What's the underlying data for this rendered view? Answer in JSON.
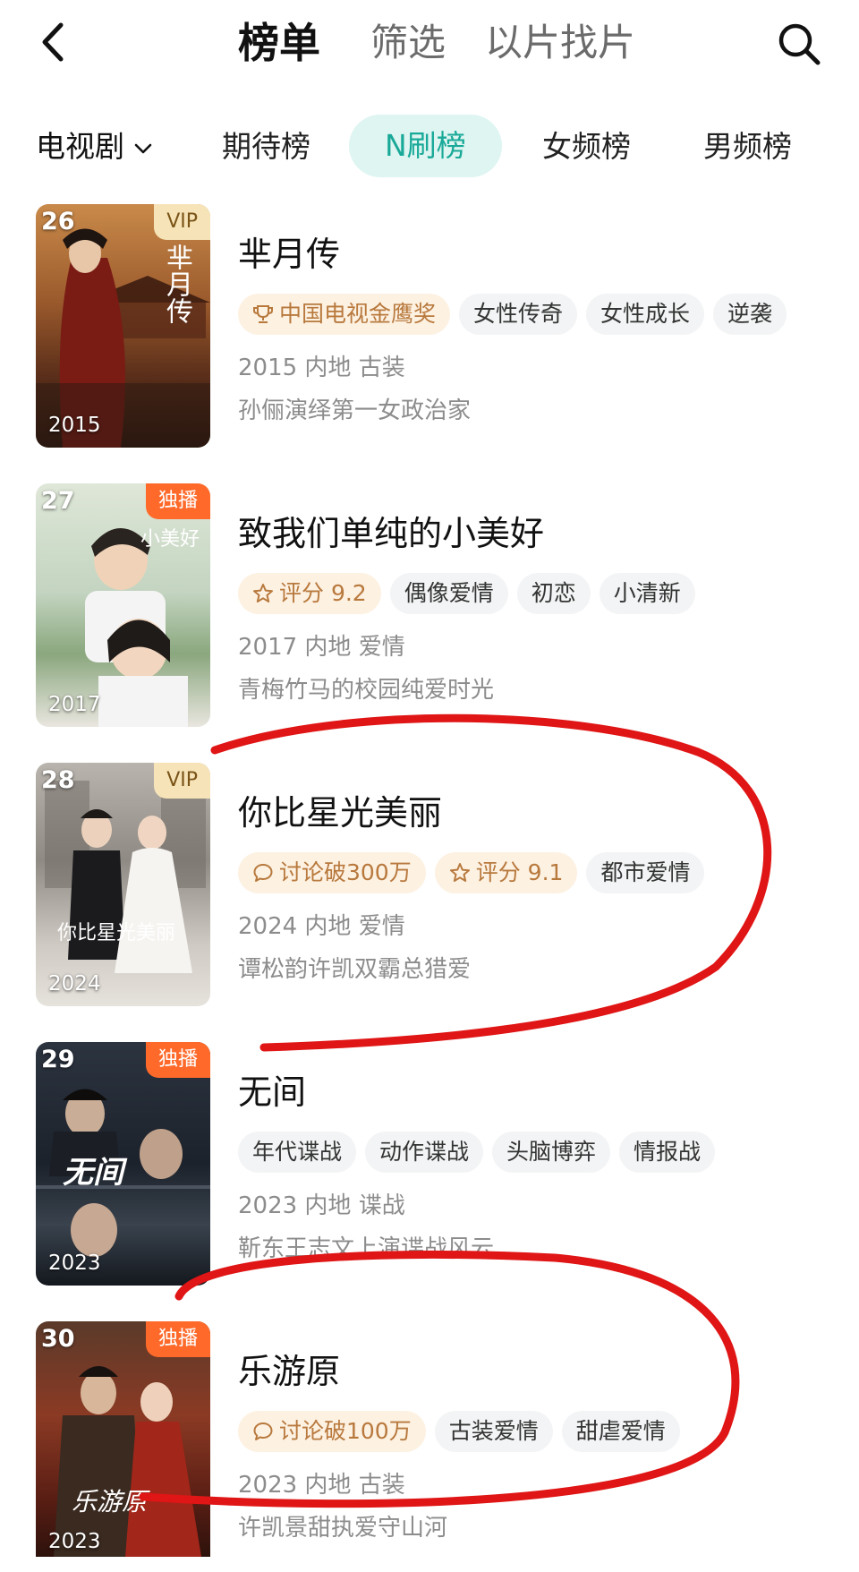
{
  "header": {
    "tabs": [
      "榜单",
      "筛选",
      "以片找片"
    ],
    "active_index": 0
  },
  "rank_tabs": {
    "category": "电视剧",
    "tabs": [
      "期待榜",
      "N刷榜",
      "女频榜",
      "男频榜"
    ],
    "active_index": 1
  },
  "colors": {
    "accent": "#19a998",
    "highlight_tag_text": "#b8793d",
    "exclusive_badge": "#ff6a2b",
    "vip_badge": "#f6e4b8",
    "annotation_red": "#e01515"
  },
  "items": [
    {
      "rank": "26",
      "badge": "VIP",
      "badge_type": "vip",
      "poster_year": "2015",
      "poster_text": "芈月传",
      "title": "芈月传",
      "tags": [
        {
          "icon": "trophy-icon",
          "text": "中国电视金鹰奖",
          "highlight": true
        },
        {
          "text": "女性传奇"
        },
        {
          "text": "女性成长"
        },
        {
          "text": "逆袭"
        }
      ],
      "meta": "2015 内地 古装",
      "desc": "孙俪演绎第一女政治家"
    },
    {
      "rank": "27",
      "badge": "独播",
      "badge_type": "exclusive",
      "poster_year": "2017",
      "poster_text": "小美好",
      "title": "致我们单纯的小美好",
      "tags": [
        {
          "icon": "star-icon",
          "text": "评分 9.2",
          "highlight": true
        },
        {
          "text": "偶像爱情"
        },
        {
          "text": "初恋"
        },
        {
          "text": "小清新"
        }
      ],
      "meta": "2017 内地 爱情",
      "desc": "青梅竹马的校园纯爱时光"
    },
    {
      "rank": "28",
      "badge": "VIP",
      "badge_type": "vip",
      "poster_year": "2024",
      "poster_text": "你比星光美丽",
      "title": "你比星光美丽",
      "tags": [
        {
          "icon": "comment-icon",
          "text": "讨论破300万",
          "highlight": true
        },
        {
          "icon": "star-icon",
          "text": "评分 9.1",
          "highlight": true
        },
        {
          "text": "都市爱情"
        }
      ],
      "meta": "2024 内地 爱情",
      "desc": "谭松韵许凯双霸总猎爱"
    },
    {
      "rank": "29",
      "badge": "独播",
      "badge_type": "exclusive",
      "poster_year": "2023",
      "poster_text": "无间",
      "title": "无间",
      "tags": [
        {
          "text": "年代谍战"
        },
        {
          "text": "动作谍战"
        },
        {
          "text": "头脑博弈"
        },
        {
          "text": "情报战"
        }
      ],
      "meta": "2023 内地 谍战",
      "desc": "靳东王志文上演谍战风云"
    },
    {
      "rank": "30",
      "badge": "独播",
      "badge_type": "exclusive",
      "poster_year": "2023",
      "poster_text": "乐游原",
      "title": "乐游原",
      "tags": [
        {
          "icon": "comment-icon",
          "text": "讨论破100万",
          "highlight": true
        },
        {
          "text": "古装爱情"
        },
        {
          "text": "甜虐爱情"
        }
      ],
      "meta": "2023 内地 古装",
      "desc": "许凯景甜执爱守山河"
    }
  ]
}
